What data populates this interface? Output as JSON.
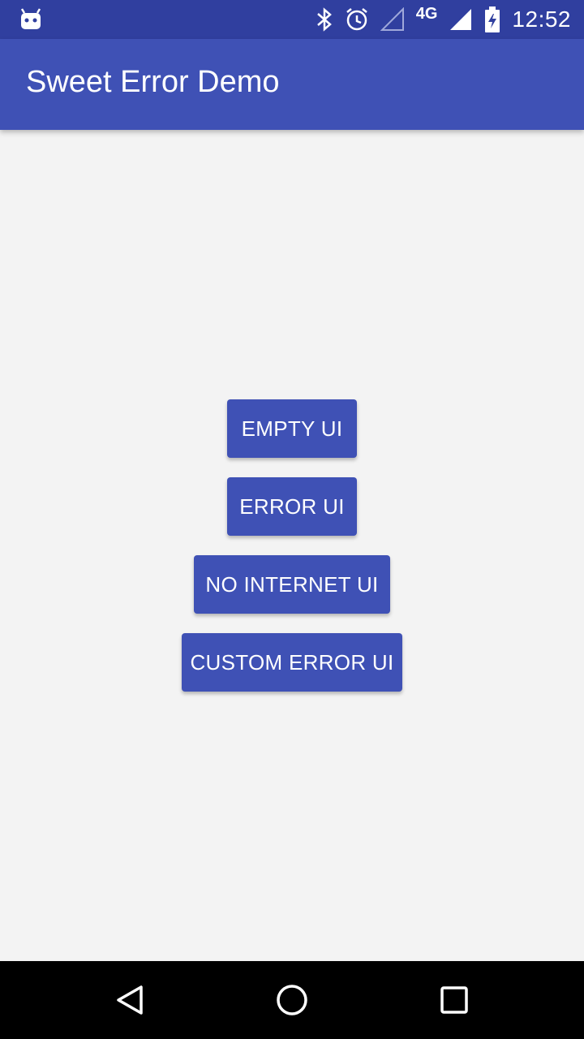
{
  "status_bar": {
    "network_type": "4G",
    "time": "12:52",
    "icons": [
      "android-debug-icon",
      "bluetooth-icon",
      "alarm-icon",
      "signal-empty-icon",
      "signal-full-icon",
      "battery-charging-icon"
    ]
  },
  "app_bar": {
    "title": "Sweet Error Demo",
    "color": "#3f51b5"
  },
  "buttons": [
    {
      "label": "EMPTY UI"
    },
    {
      "label": "ERROR UI"
    },
    {
      "label": "NO INTERNET UI"
    },
    {
      "label": "CUSTOM ERROR UI"
    }
  ],
  "nav_bar": {
    "icons": [
      "back-icon",
      "home-icon",
      "recents-icon"
    ]
  },
  "colors": {
    "primary": "#3f51b5",
    "primary_dark": "#303f9f",
    "background": "#f3f3f3"
  }
}
